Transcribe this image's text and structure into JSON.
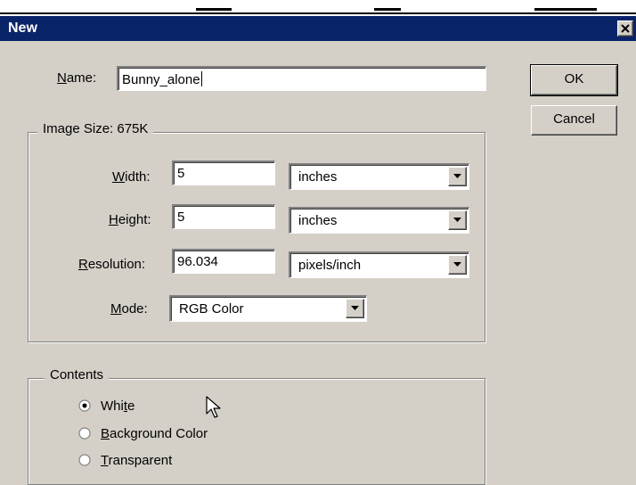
{
  "window": {
    "title": "New",
    "close_glyph": "✕"
  },
  "name_field": {
    "label_accel": "N",
    "label_rest": "ame:",
    "value": "Bunny_alone"
  },
  "buttons": {
    "ok": "OK",
    "cancel": "Cancel"
  },
  "image_size": {
    "legend": "Image Size: 675K",
    "width": {
      "label_accel": "W",
      "label_rest": "idth:",
      "value": "5",
      "unit": "inches"
    },
    "height": {
      "label_accel": "H",
      "label_rest": "eight:",
      "value": "5",
      "unit": "inches"
    },
    "resolution": {
      "label_accel": "R",
      "label_rest": "esolution:",
      "value": "96.034",
      "unit": "pixels/inch"
    },
    "mode": {
      "label_accel": "M",
      "label_rest": "ode:",
      "value": "RGB Color"
    }
  },
  "contents": {
    "legend": "Contents",
    "options": [
      {
        "label_pre": "Whi",
        "label_accel": "t",
        "label_post": "e",
        "checked": true
      },
      {
        "label_pre": "",
        "label_accel": "B",
        "label_post": "ackground Color",
        "checked": false
      },
      {
        "label_pre": "",
        "label_accel": "T",
        "label_post": "ransparent",
        "checked": false
      }
    ]
  },
  "icons": {
    "close": "close-icon",
    "dropdown": "chevron-down-icon",
    "radio": "radio-button-icon",
    "cursor": "mouse-pointer-icon"
  },
  "colors": {
    "titlebar": "#0a246a",
    "face": "#d4d0c8"
  }
}
